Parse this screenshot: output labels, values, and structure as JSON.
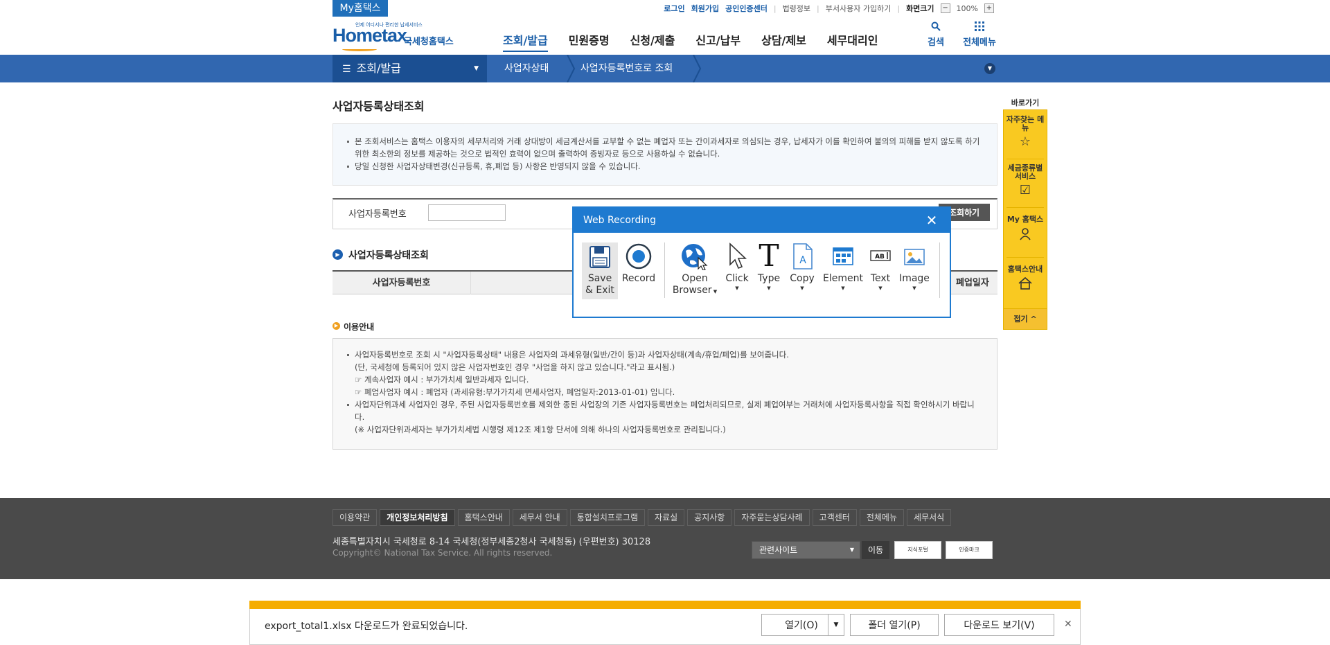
{
  "top": {
    "my_tab": "My홈택스",
    "links": [
      "로그인",
      "회원가입",
      "공인인증센터",
      "법령정보",
      "부서사용자 가입하기"
    ],
    "zoom_label": "화면크기",
    "zoom_value": "100%",
    "zoom_minus": "−",
    "zoom_plus": "+"
  },
  "logo": {
    "word": "Hometax",
    "tag": "언제 어디서나 편리한 납세서비스",
    "org": "국세청홈택스"
  },
  "nav": {
    "items": [
      "조회/발급",
      "민원증명",
      "신청/제출",
      "신고/납부",
      "상담/제보",
      "세무대리인"
    ],
    "search_label": "검색",
    "menu_label": "전체메뉴"
  },
  "subbar": {
    "section": "조회/발급",
    "crumb1": "사업자상태",
    "crumb2": "사업자등록번호로 조회"
  },
  "page": {
    "title": "사업자등록상태조회",
    "info": [
      "본 조회서비스는 홈택스 이용자의 세무처리와 거래 상대방이 세금계산서를 교부할 수 없는 폐업자 또는 간이과세자로 의심되는 경우, 납세자가 이를 확인하여 불의의 피해를 받지 않도록 하기 위한 최소한의 정보를 제공하는 것으로 법적인 효력이 없으며 출력하여 증빙자료 등으로 사용하실 수 없습니다.",
      "당일 신청한 사업자상태변경(신규등록, 휴,폐업 등) 사항은 반영되지 않을 수 있습니다."
    ],
    "search_label": "사업자등록번호",
    "search_value": "",
    "search_button": "조회하기",
    "result_title": "사업자등록상태조회",
    "result_col1": "사업자등록번호",
    "result_col3": "폐업일자",
    "guide_title": "이용안내",
    "guide": {
      "b1": "사업자등록번호로 조회 시 \"사업자등록상태\" 내용은 사업자의 과세유형(일반/간이 등)과 사업자상태(계속/휴업/폐업)를 보여줍니다.",
      "b1a": "(단, 국세청에 등록되어 있지 않은 사업자번호인 경우 \"사업을 하지 않고 있습니다.\"라고 표시됨.)",
      "b1b": "☞ 계속사업자 예시 : 부가가치세 일반과세자 입니다.",
      "b1c": "☞ 폐업사업자 예시 : 폐업자 (과세유형:부가가치세 면세사업자, 폐업일자:2013-01-01) 입니다.",
      "b2": "사업자단위과세 사업자인 경우, 주된 사업자등록번호를 제외한 종된 사업장의 기존 사업자등록번호는 폐업처리되므로, 실제 폐업여부는 거래처에 사업자등록사항을 직접 확인하시기 바랍니다.",
      "b2a": "(※ 사업자단위과세자는 부가가치세법 시행령 제12조 제1항 단서에 의해 하나의 사업자등록번호로 관리됩니다.)"
    }
  },
  "quick": {
    "title": "바로가기",
    "items": [
      {
        "label": "자주찾는 메뉴",
        "icon": "star-icon"
      },
      {
        "label": "세금종류별 서비스",
        "icon": "checkbox-icon"
      },
      {
        "label": "My 홈택스",
        "icon": "person-icon"
      },
      {
        "label": "홈택스안내",
        "icon": "house-icon"
      }
    ],
    "close_label": "접기"
  },
  "footer": {
    "links": [
      "이용약관",
      "개인정보처리방침",
      "홈택스안내",
      "세무서 안내",
      "통합설치프로그램",
      "자료실",
      "공지사항",
      "자주묻는상담사례",
      "고객센터",
      "전체메뉴",
      "세무서식"
    ],
    "address": "세종특별자치시 국세청로 8-14 국세청(정부세종2청사 국세청동) (우편번호) 30128",
    "copyright": "Copyright© National Tax Service. All rights reserved.",
    "related": "관련사이트",
    "goto": "이동",
    "badge1": "지식포털",
    "badge2": "인증마크"
  },
  "recorder": {
    "title": "Web Recording",
    "tools": [
      {
        "l1": "Save",
        "l2": "& Exit",
        "icon": "floppy-disk-icon"
      },
      {
        "l1": "Record",
        "l2": "",
        "icon": "record-icon"
      },
      {
        "l1": "Open",
        "l2": "Browser",
        "icon": "globe-cursor-icon"
      },
      {
        "l1": "Click",
        "l2": "",
        "icon": "cursor-icon"
      },
      {
        "l1": "Type",
        "l2": "",
        "icon": "type-icon"
      },
      {
        "l1": "Copy",
        "l2": "",
        "icon": "document-icon"
      },
      {
        "l1": "Element",
        "l2": "",
        "icon": "element-icon"
      },
      {
        "l1": "Text",
        "l2": "",
        "icon": "text-box-icon"
      },
      {
        "l1": "Image",
        "l2": "",
        "icon": "image-icon"
      }
    ]
  },
  "download": {
    "message": "export_total1.xlsx 다운로드가 완료되었습니다.",
    "open": "열기(O)",
    "open_folder": "폴더 열기(P)",
    "view": "다운로드 보기(V)",
    "close": "✕"
  },
  "colors": {
    "brand_blue": "#1a5ea8",
    "bar_blue": "#3167b0",
    "dialog_blue": "#1e7ad0",
    "quick_yellow": "#f9c921",
    "download_orange": "#f5ad00"
  }
}
